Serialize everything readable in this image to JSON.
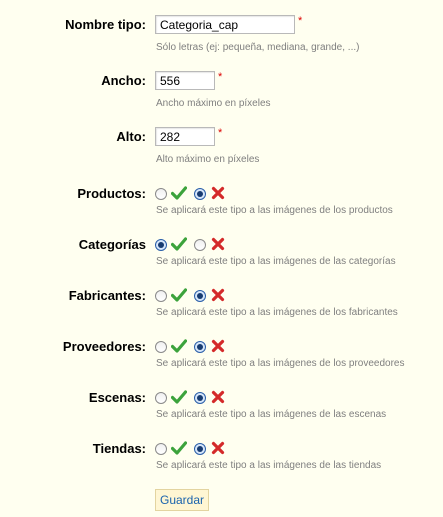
{
  "form": {
    "nombre": {
      "label": "Nombre tipo:",
      "value": "Categoria_cap",
      "required": "*",
      "hint": "Sólo letras (ej: pequeña, mediana, grande, ...)"
    },
    "ancho": {
      "label": "Ancho:",
      "value": "556",
      "required": "*",
      "hint": "Ancho máximo en píxeles"
    },
    "alto": {
      "label": "Alto:",
      "value": "282",
      "required": "*",
      "hint": "Alto máximo en píxeles"
    },
    "options": [
      {
        "label": "Productos:",
        "selected": "no",
        "hint": "Se aplicará este tipo a las imágenes de los productos"
      },
      {
        "label": "Categorías",
        "selected": "yes",
        "hint": "Se aplicará este tipo a las imágenes de las categorías"
      },
      {
        "label": "Fabricantes:",
        "selected": "no",
        "hint": "Se aplicará este tipo a las imágenes de los fabricantes"
      },
      {
        "label": "Proveedores:",
        "selected": "no",
        "hint": "Se aplicará este tipo a las imágenes de los proveedores"
      },
      {
        "label": "Escenas:",
        "selected": "no",
        "hint": "Se aplicará este tipo a las imágenes de las escenas"
      },
      {
        "label": "Tiendas:",
        "selected": "no",
        "hint": "Se aplicará este tipo a las imágenes de las tiendas"
      }
    ],
    "icons": {
      "yes": "check-icon",
      "no": "cross-icon"
    },
    "colors": {
      "check": "#3ca33c",
      "cross": "#d42a2a",
      "hint": "#7f7f7f",
      "required": "#dd0000"
    },
    "submit_label": "Guardar"
  }
}
